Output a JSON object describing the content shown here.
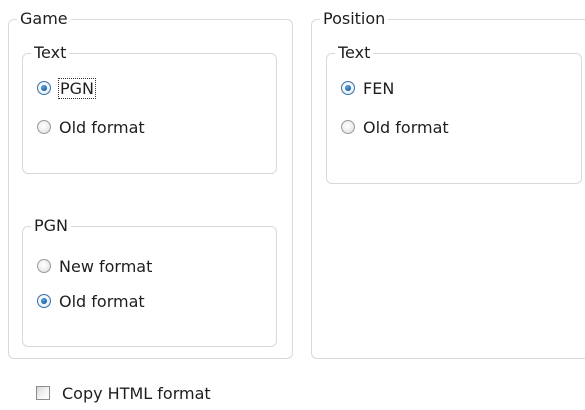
{
  "game": {
    "title": "Game",
    "text": {
      "title": "Text",
      "options": [
        "PGN",
        "Old format"
      ],
      "selected_index": 0
    },
    "pgn": {
      "title": "PGN",
      "options": [
        "New format",
        "Old format"
      ],
      "selected_index": 1
    }
  },
  "position": {
    "title": "Position",
    "text": {
      "title": "Text",
      "options": [
        "FEN",
        "Old format"
      ],
      "selected_index": 0
    }
  },
  "copy_html": {
    "label": "Copy HTML format",
    "checked": false
  },
  "colors": {
    "group_border": "#d9d9d9",
    "radio_selected": "#1b5fa3",
    "text": "#1e1e1e"
  }
}
